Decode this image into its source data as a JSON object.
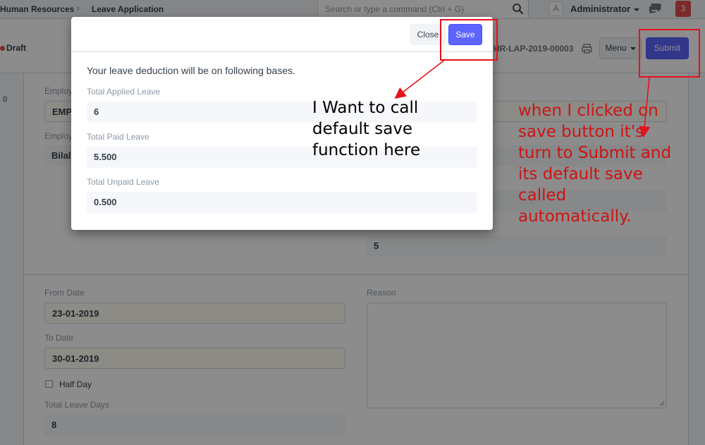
{
  "navbar": {
    "breadcrumbs": [
      "Human Resources",
      "Leave Application"
    ],
    "search_placeholder": "Search or type a command (Ctrl + G)",
    "avatar_initial": "A",
    "user_name": "Administrator",
    "notification_count": "3"
  },
  "page_head": {
    "status": "Draft",
    "doc_name": "HR-LAP-2019-00003",
    "menu_label": "Menu",
    "submit_label": "Submit",
    "sidebar_count": "0"
  },
  "form": {
    "employee_label": "Employ",
    "employee_value": "EMP",
    "employee_name_label": "Employ",
    "employee_name_value": "Bilal",
    "right_value": "5",
    "from_date_label": "From Date",
    "from_date_value": "23-01-2019",
    "to_date_label": "To Date",
    "to_date_value": "30-01-2019",
    "half_day_label": "Half Day",
    "total_leave_days_label": "Total Leave Days",
    "total_leave_days_value": "8",
    "reason_label": "Reason"
  },
  "modal": {
    "close_label": "Close",
    "save_label": "Save",
    "message": "Your leave deduction will be on following bases.",
    "fields": [
      {
        "label": "Total Applied Leave",
        "value": "6"
      },
      {
        "label": "Total Paid Leave",
        "value": "5.500"
      },
      {
        "label": "Total Unpaid Leave",
        "value": "0.500"
      }
    ]
  },
  "annotations": {
    "left_note": "I Want to call\ndefault save\nfunction here",
    "right_note": "when I clicked on\nsave button it's\nturn to Submit and\nits default save\ncalled\nautomatically."
  },
  "colors": {
    "primary": "#5e64ff",
    "annotation_red": "#e8101c",
    "danger": "#e24c4c"
  }
}
